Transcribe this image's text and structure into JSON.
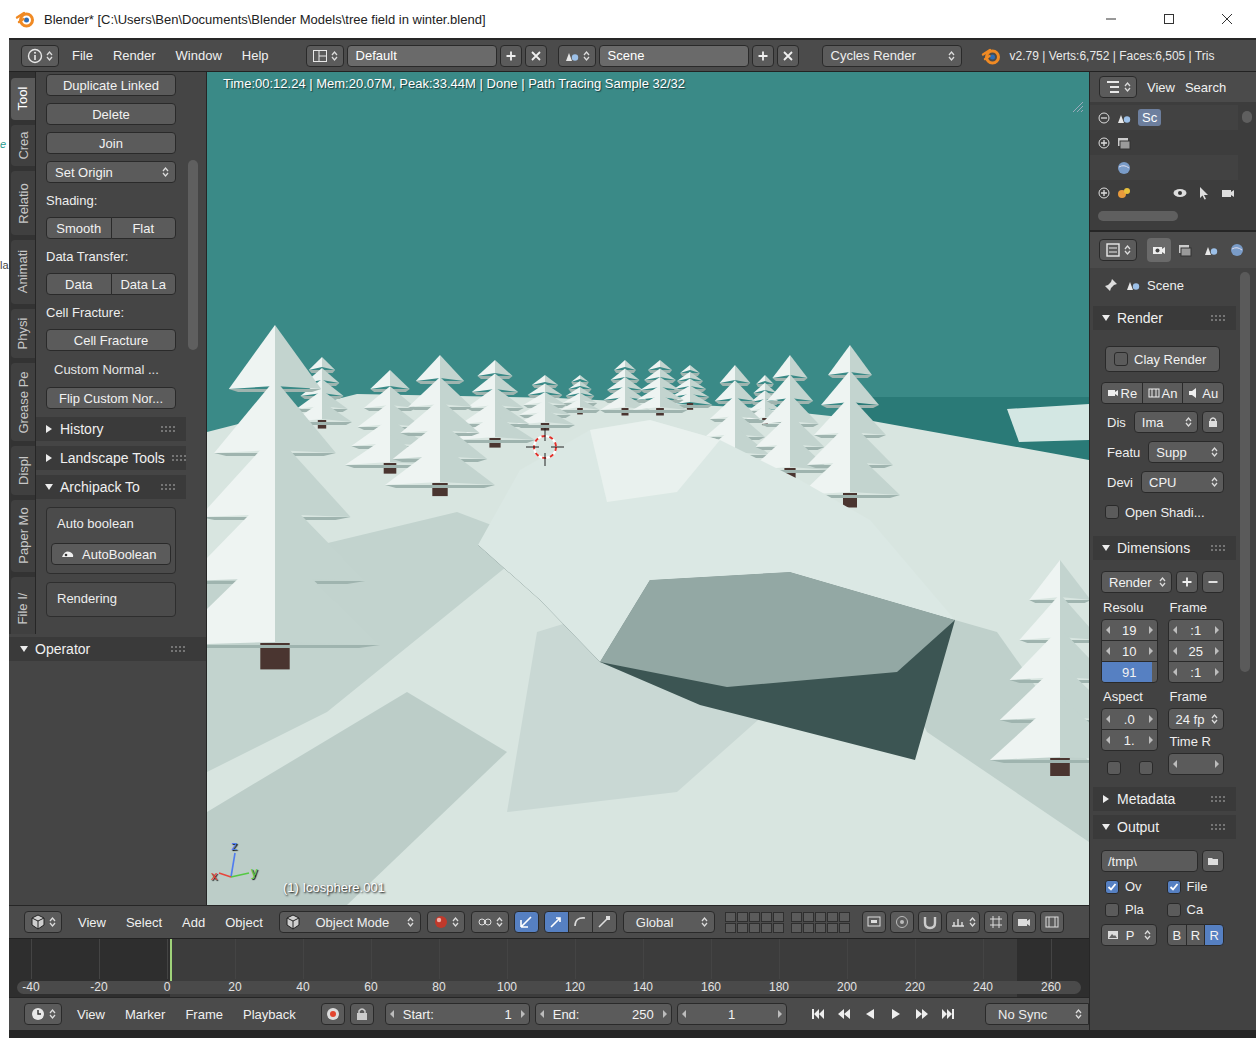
{
  "window": {
    "title": "Blender* [C:\\Users\\Ben\\Documents\\Blender Models\\tree field in winter.blend]",
    "desktop_fragments": [
      "e",
      "la"
    ]
  },
  "info_header": {
    "menus": [
      "File",
      "Render",
      "Window",
      "Help"
    ],
    "layout": "Default",
    "scene": "Scene",
    "engine": "Cycles Render",
    "stats": "v2.79 | Verts:6,752 | Faces:6,505 | Tris"
  },
  "tool_shelf": {
    "tabs": [
      {
        "label": "Tool",
        "selected": true
      },
      {
        "label": "Crea",
        "selected": false
      },
      {
        "label": "Relatio",
        "selected": false
      },
      {
        "label": "Animati",
        "selected": false
      },
      {
        "label": "Physi",
        "selected": false
      },
      {
        "label": "Grease Pe",
        "selected": false
      },
      {
        "label": "Displ",
        "selected": false
      },
      {
        "label": "Paper Mo",
        "selected": false
      },
      {
        "label": "File I/",
        "selected": false
      }
    ],
    "items": [
      {
        "kind": "button",
        "label": "Duplicate Linked"
      },
      {
        "kind": "button",
        "label": "Delete"
      },
      {
        "kind": "button",
        "label": "Join"
      },
      {
        "kind": "dropdown",
        "label": "Set Origin"
      },
      {
        "kind": "label",
        "label": "Shading:"
      },
      {
        "kind": "pair",
        "labels": [
          "Smooth",
          "Flat"
        ]
      },
      {
        "kind": "label",
        "label": "Data Transfer:"
      },
      {
        "kind": "pair",
        "labels": [
          "Data",
          "Data La"
        ]
      },
      {
        "kind": "label",
        "label": "Cell Fracture:"
      },
      {
        "kind": "button",
        "label": "Cell Fracture"
      },
      {
        "kind": "plain",
        "label": "Custom Normal ..."
      },
      {
        "kind": "button",
        "label": "Flip Custom Nor..."
      }
    ],
    "subpanels": [
      {
        "title": "History",
        "expanded": false,
        "boxes": []
      },
      {
        "title": "Landscape Tools",
        "expanded": false,
        "boxes": []
      },
      {
        "title": "Archipack To",
        "expanded": true,
        "boxes": [
          {
            "label": "Auto boolean",
            "button": "AutoBoolean"
          },
          {
            "label": "Rendering"
          }
        ]
      }
    ],
    "operator": {
      "title": "Operator",
      "expanded": true
    }
  },
  "viewport": {
    "render_info": "Time:00:12.24 | Mem:20.07M, Peak:33.44M | Done | Path Tracing Sample 32/32",
    "object_label": "(1) Icosphere.001",
    "axes": [
      {
        "label": "z",
        "color": "#4f7cf0"
      },
      {
        "label": "y",
        "color": "#55c844"
      },
      {
        "label": "x",
        "color": "#e8463c"
      }
    ]
  },
  "view3d_header": {
    "menus": [
      "View",
      "Select",
      "Add",
      "Object"
    ],
    "mode": "Object Mode",
    "manipulators": [
      {
        "kind": "toggle",
        "selected": true
      },
      {
        "kind": "translate",
        "selected": true
      },
      {
        "kind": "rotate",
        "selected": false
      },
      {
        "kind": "scale",
        "selected": false
      }
    ],
    "orientation": "Global"
  },
  "timeline": {
    "ticks": [
      "-40",
      "-20",
      "0",
      "20",
      "40",
      "60",
      "80",
      "100",
      "120",
      "140",
      "160",
      "180",
      "200",
      "220",
      "240",
      "260"
    ]
  },
  "timeline_header": {
    "menus": [
      "View",
      "Marker",
      "Frame",
      "Playback"
    ],
    "start_label": "Start:",
    "start": "1",
    "end_label": "End:",
    "end": "250",
    "current": "1",
    "sync": "No Sync"
  },
  "outliner": {
    "menus": [
      "View",
      "Search"
    ],
    "rows": [
      {
        "kind": "scene",
        "label": "Sc",
        "selected": true,
        "expandable": true,
        "expanded": true
      },
      {
        "kind": "render-layers",
        "selected": false,
        "expandable": true,
        "expanded": false
      },
      {
        "kind": "world",
        "selected": false,
        "expandable": false,
        "expanded": false
      },
      {
        "kind": "object",
        "selected": false,
        "expandable": true,
        "expanded": false
      }
    ]
  },
  "properties": {
    "tabs": [
      {
        "kind": "render",
        "selected": true
      },
      {
        "kind": "render-layers",
        "selected": false
      },
      {
        "kind": "scene",
        "selected": false
      },
      {
        "kind": "world",
        "selected": false
      }
    ],
    "context": "Scene",
    "render": {
      "title": "Render",
      "expanded": true,
      "clay": {
        "label": "Clay Render",
        "checked": false
      },
      "actions": [
        "Re",
        "An",
        "Au"
      ],
      "display": {
        "label": "Dis",
        "value": "Ima"
      },
      "feature": {
        "label": "Featu",
        "value": "Supp"
      },
      "device": {
        "label": "Devi",
        "value": "CPU"
      },
      "open_shading": {
        "label": "Open Shadi...",
        "checked": false
      }
    },
    "dimensions": {
      "title": "Dimensions",
      "expanded": true,
      "preset": "Render",
      "resolution_label": "Resolu",
      "resolution": [
        "19",
        "10"
      ],
      "percentage": {
        "value": "91",
        "level": 0.91
      },
      "frame_label": "Frame",
      "frames": [
        ":1",
        "25",
        ":1"
      ],
      "aspect_label": "Aspect",
      "aspect": [
        ".0",
        "1."
      ],
      "rate_label": "Frame",
      "rate": "24 fp",
      "time_label": "Time R",
      "options": [
        {
          "checked": false
        },
        {
          "checked": false
        }
      ]
    },
    "metadata": {
      "title": "Metadata",
      "expanded": false
    },
    "output": {
      "title": "Output",
      "expanded": true,
      "path": "/tmp\\",
      "options": [
        {
          "label": "Ov",
          "checked": true
        },
        {
          "label": "File",
          "checked": true
        },
        {
          "label": "Pla",
          "checked": false
        },
        {
          "label": "Ca",
          "checked": false
        }
      ],
      "format": "P",
      "color_modes": [
        {
          "label": "B",
          "selected": false
        },
        {
          "label": "R",
          "selected": false
        },
        {
          "label": "R",
          "selected": true
        }
      ]
    }
  }
}
